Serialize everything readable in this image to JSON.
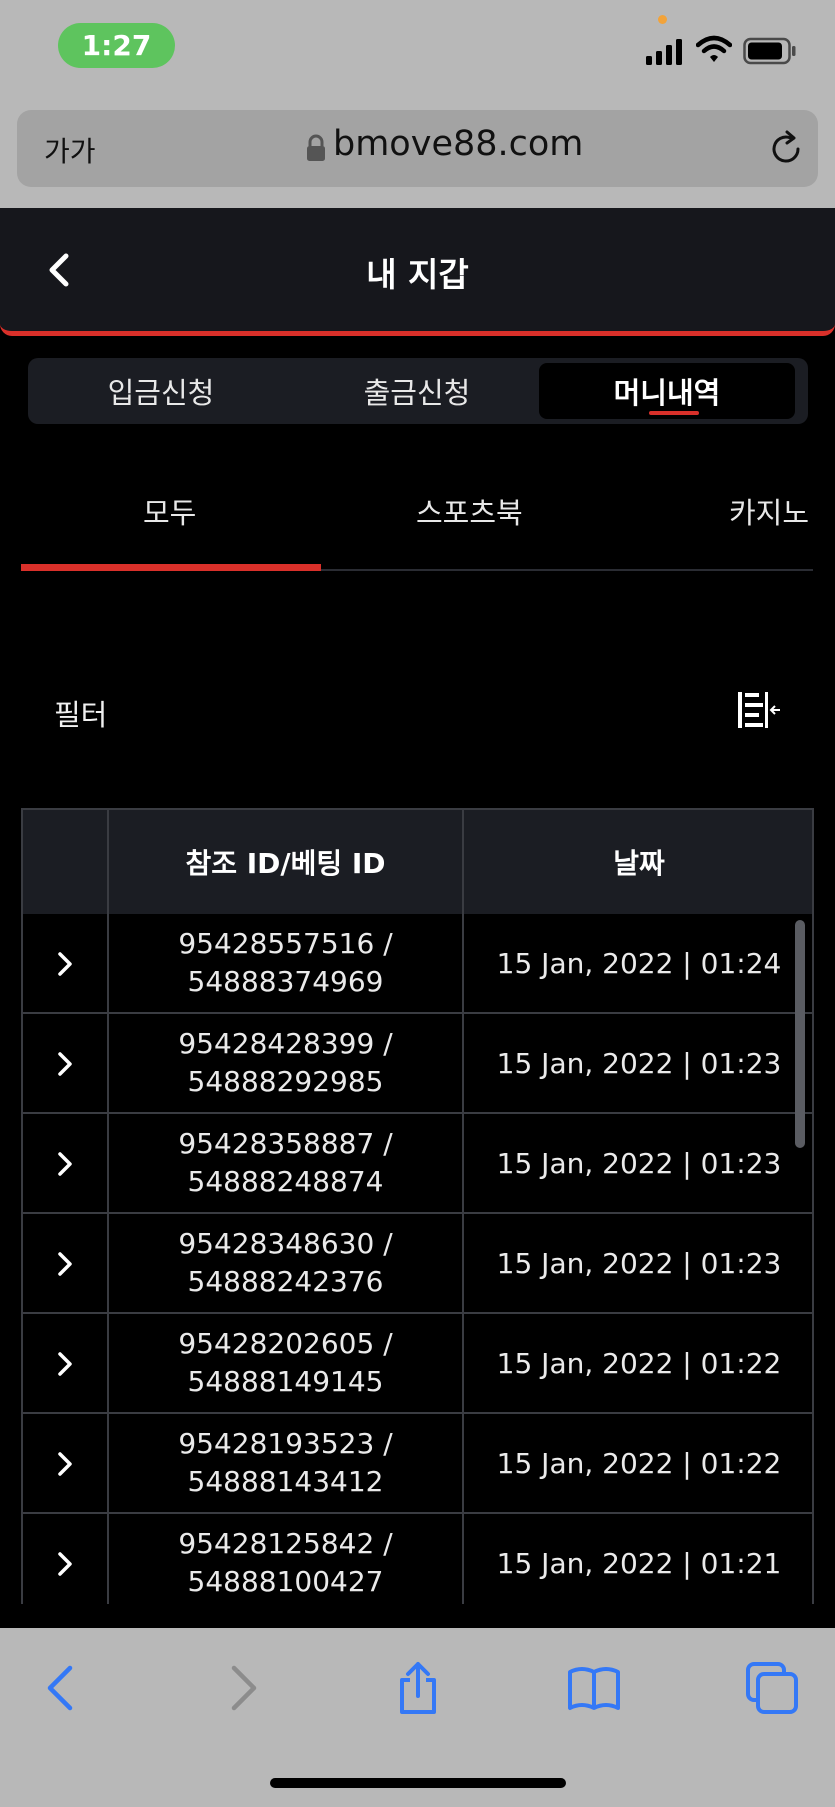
{
  "status_bar": {
    "time": "1:27"
  },
  "browser": {
    "aa_label": "가가",
    "url": "bmove88.com"
  },
  "header": {
    "title": "내 지갑"
  },
  "segment_tabs": [
    {
      "label": "입금신청",
      "active": false
    },
    {
      "label": "출금신청",
      "active": false
    },
    {
      "label": "머니내역",
      "active": true
    }
  ],
  "category_tabs": [
    {
      "label": "모두",
      "active": true
    },
    {
      "label": "스포츠북",
      "active": false
    },
    {
      "label": "카지노",
      "active": false
    }
  ],
  "filter": {
    "label": "필터"
  },
  "table": {
    "columns": [
      "",
      "참조 ID/베팅 ID",
      "날짜"
    ],
    "rows": [
      {
        "ref": "95428557516 /",
        "bet": "54888374969",
        "date": "15 Jan, 2022 | 01:24"
      },
      {
        "ref": "95428428399 /",
        "bet": "54888292985",
        "date": "15 Jan, 2022 | 01:23"
      },
      {
        "ref": "95428358887 /",
        "bet": "54888248874",
        "date": "15 Jan, 2022 | 01:23"
      },
      {
        "ref": "95428348630 /",
        "bet": "54888242376",
        "date": "15 Jan, 2022 | 01:23"
      },
      {
        "ref": "95428202605 /",
        "bet": "54888149145",
        "date": "15 Jan, 2022 | 01:22"
      },
      {
        "ref": "95428193523 /",
        "bet": "54888143412",
        "date": "15 Jan, 2022 | 01:22"
      },
      {
        "ref": "95428125842 /",
        "bet": "54888100427",
        "date": "15 Jan, 2022 | 01:21"
      }
    ]
  },
  "colors": {
    "accent": "#d9302a",
    "background": "#000000",
    "panel": "#1b1d23",
    "ios_blue": "#3478f6"
  }
}
